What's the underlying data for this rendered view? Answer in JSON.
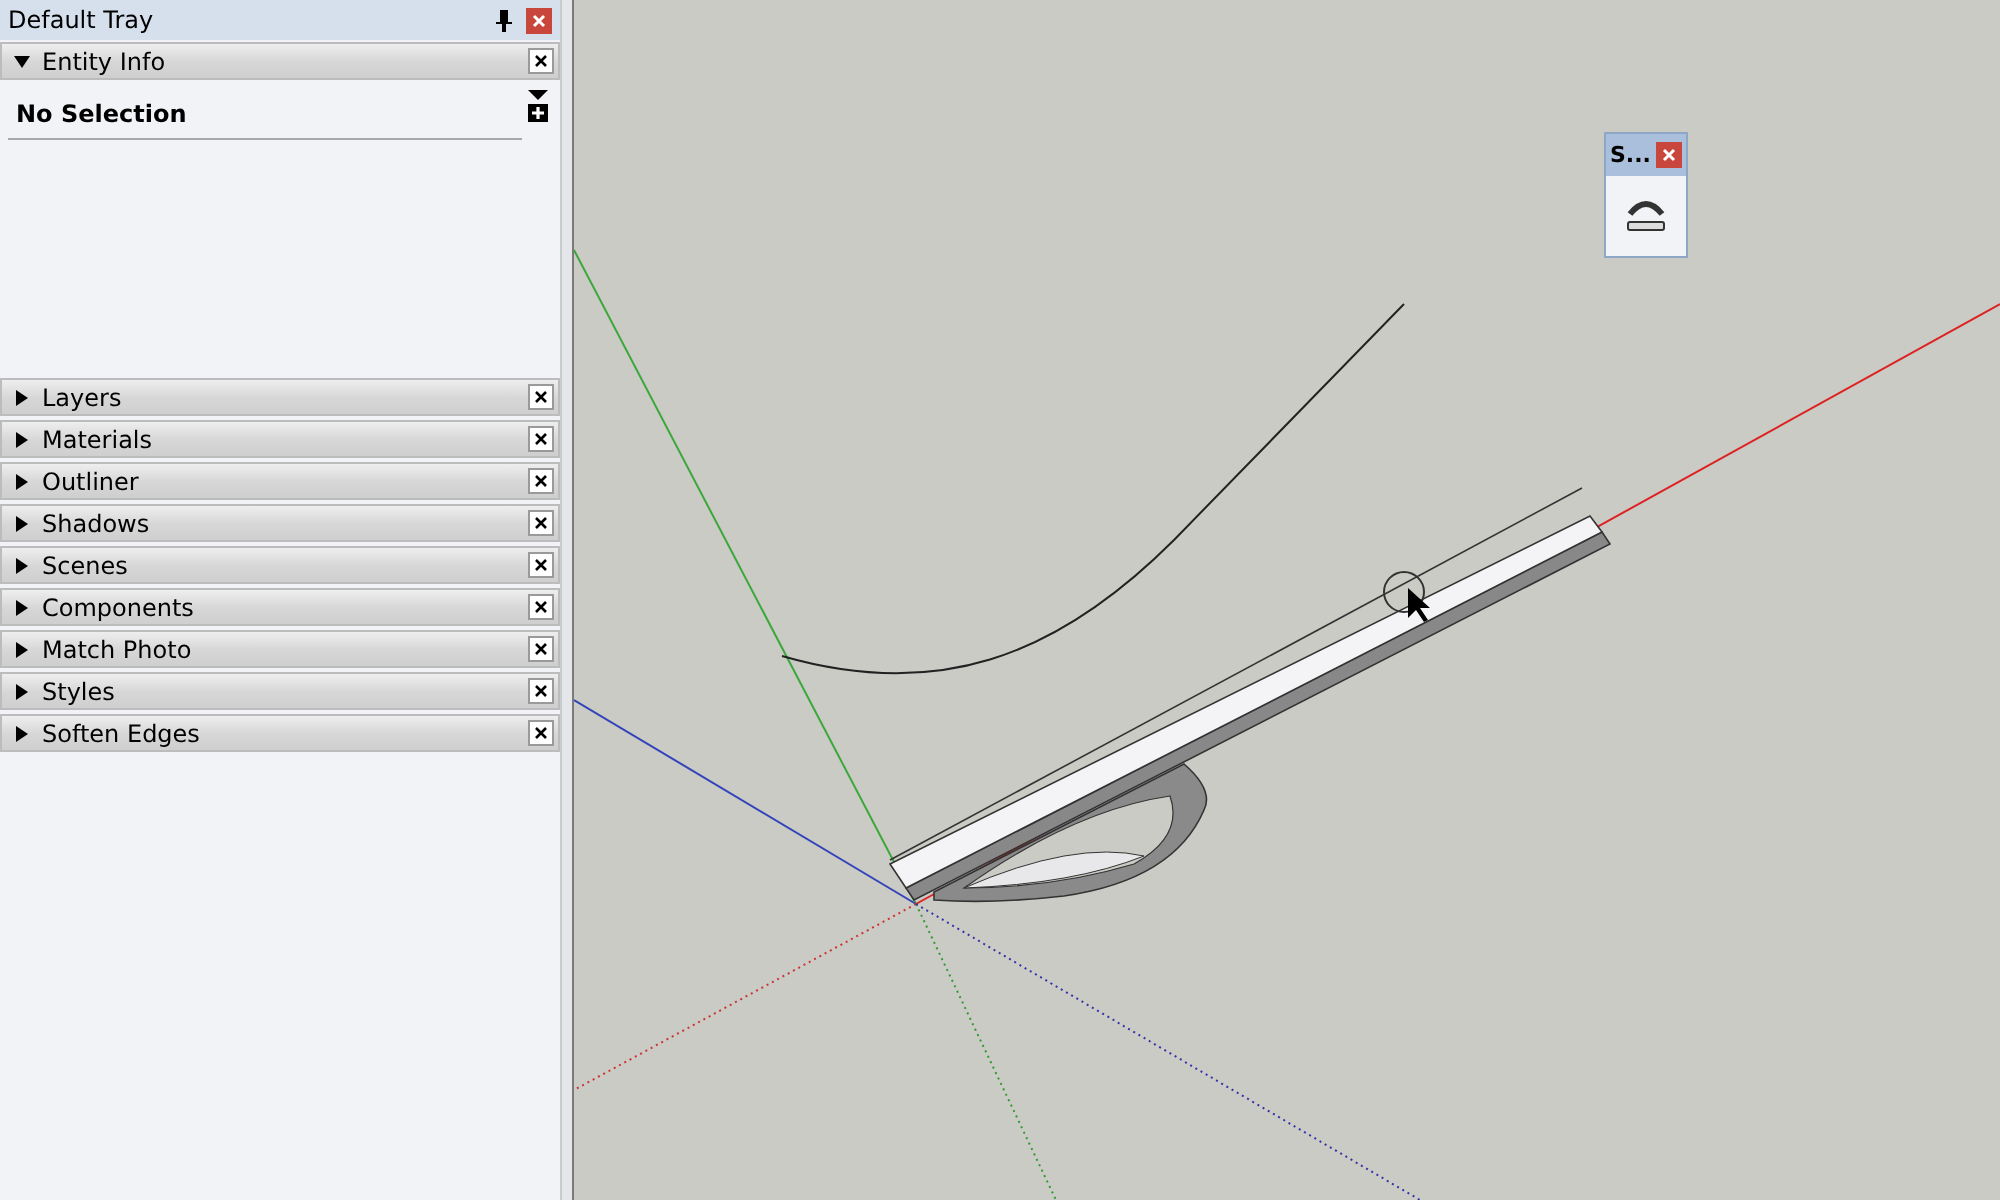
{
  "tray": {
    "title": "Default Tray"
  },
  "panels": [
    {
      "label": "Entity Info",
      "expanded": true,
      "selection": "No Selection"
    },
    {
      "label": "Layers",
      "expanded": false
    },
    {
      "label": "Materials",
      "expanded": false
    },
    {
      "label": "Outliner",
      "expanded": false
    },
    {
      "label": "Shadows",
      "expanded": false
    },
    {
      "label": "Scenes",
      "expanded": false
    },
    {
      "label": "Components",
      "expanded": false
    },
    {
      "label": "Match Photo",
      "expanded": false
    },
    {
      "label": "Styles",
      "expanded": false
    },
    {
      "label": "Soften Edges",
      "expanded": false
    }
  ],
  "floating_toolbar": {
    "title": "S..."
  }
}
